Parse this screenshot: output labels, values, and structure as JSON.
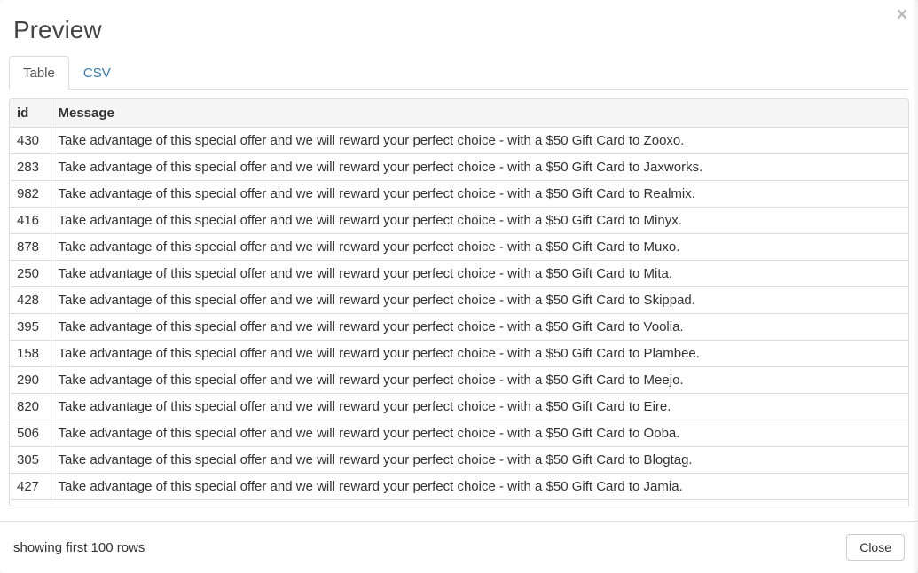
{
  "modal": {
    "title": "Preview",
    "close_label": "×"
  },
  "tabs": [
    {
      "label": "Table",
      "active": true
    },
    {
      "label": "CSV",
      "active": false
    }
  ],
  "table": {
    "columns": [
      {
        "key": "id",
        "label": "id"
      },
      {
        "key": "message",
        "label": "Message"
      }
    ],
    "rows": [
      {
        "id": "430",
        "message": "Take advantage of this special offer and we will reward your perfect choice - with a $50 Gift Card to Zooxo."
      },
      {
        "id": "283",
        "message": "Take advantage of this special offer and we will reward your perfect choice - with a $50 Gift Card to Jaxworks."
      },
      {
        "id": "982",
        "message": "Take advantage of this special offer and we will reward your perfect choice - with a $50 Gift Card to Realmix."
      },
      {
        "id": "416",
        "message": "Take advantage of this special offer and we will reward your perfect choice - with a $50 Gift Card to Minyx."
      },
      {
        "id": "878",
        "message": "Take advantage of this special offer and we will reward your perfect choice - with a $50 Gift Card to Muxo."
      },
      {
        "id": "250",
        "message": "Take advantage of this special offer and we will reward your perfect choice - with a $50 Gift Card to Mita."
      },
      {
        "id": "428",
        "message": "Take advantage of this special offer and we will reward your perfect choice - with a $50 Gift Card to Skippad."
      },
      {
        "id": "395",
        "message": "Take advantage of this special offer and we will reward your perfect choice - with a $50 Gift Card to Voolia."
      },
      {
        "id": "158",
        "message": "Take advantage of this special offer and we will reward your perfect choice - with a $50 Gift Card to Plambee."
      },
      {
        "id": "290",
        "message": "Take advantage of this special offer and we will reward your perfect choice - with a $50 Gift Card to Meejo."
      },
      {
        "id": "820",
        "message": "Take advantage of this special offer and we will reward your perfect choice - with a $50 Gift Card to Eire."
      },
      {
        "id": "506",
        "message": "Take advantage of this special offer and we will reward your perfect choice - with a $50 Gift Card to Ooba."
      },
      {
        "id": "305",
        "message": "Take advantage of this special offer and we will reward your perfect choice - with a $50 Gift Card to Blogtag."
      },
      {
        "id": "427",
        "message": "Take advantage of this special offer and we will reward your perfect choice - with a $50 Gift Card to Jamia."
      }
    ]
  },
  "footer": {
    "status": "showing first 100 rows",
    "close_button": "Close"
  }
}
